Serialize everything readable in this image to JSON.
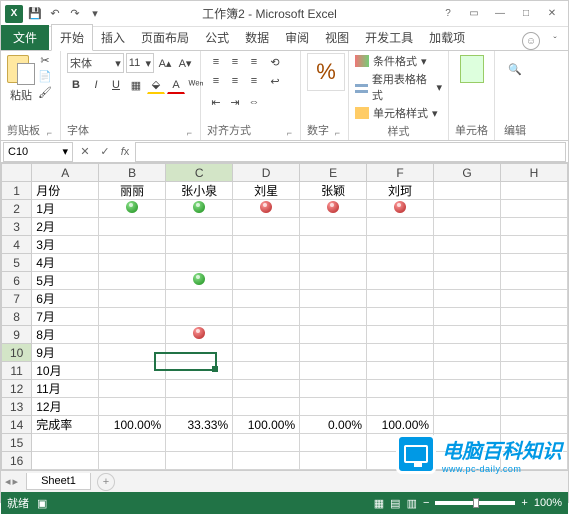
{
  "window": {
    "title": "工作簿2 - Microsoft Excel"
  },
  "qat": {
    "save": "💾",
    "undo": "↶",
    "redo": "↷",
    "customize": "▾"
  },
  "tabs": {
    "file": "文件",
    "home": "开始",
    "insert": "插入",
    "layout": "页面布局",
    "formulas": "公式",
    "data": "数据",
    "review": "审阅",
    "view": "视图",
    "developer": "开发工具",
    "addins": "加载项"
  },
  "ribbon": {
    "clipboard": {
      "paste": "粘贴",
      "label": "剪贴板"
    },
    "font": {
      "name": "宋体",
      "size": "11",
      "label": "字体"
    },
    "alignment": {
      "label": "对齐方式"
    },
    "number": {
      "label": "数字"
    },
    "styles": {
      "cond": "条件格式",
      "table": "套用表格格式",
      "cell": "单元格样式",
      "label": "样式"
    },
    "cells": {
      "label": "单元格"
    },
    "editing": {
      "label": "编辑"
    }
  },
  "namebox": {
    "value": "C10"
  },
  "columns": [
    "A",
    "B",
    "C",
    "D",
    "E",
    "F",
    "G",
    "H"
  ],
  "rows": [
    "1",
    "2",
    "3",
    "4",
    "5",
    "6",
    "7",
    "8",
    "9",
    "10",
    "11",
    "12",
    "13",
    "14",
    "15",
    "16"
  ],
  "active": {
    "col": "C",
    "row": "10"
  },
  "headers": {
    "month": "月份",
    "b": "丽丽",
    "c": "张小泉",
    "d": "刘星",
    "e": "张颖",
    "f": "刘珂"
  },
  "months": [
    "1月",
    "2月",
    "3月",
    "4月",
    "5月",
    "6月",
    "7月",
    "8月",
    "9月",
    "10月",
    "11月",
    "12月"
  ],
  "summary_label": "完成率",
  "summary": {
    "b": "100.00%",
    "c": "33.33%",
    "d": "100.00%",
    "e": "0.00%",
    "f": "100.00%"
  },
  "marks": {
    "r1": {
      "b": "green",
      "c": "green",
      "d": "red",
      "e": "red",
      "f": "red"
    },
    "r5": {
      "c": "green"
    },
    "r8": {
      "c": "red"
    }
  },
  "sheettab": {
    "name": "Sheet1"
  },
  "status": {
    "ready": "就绪",
    "zoom": "100%"
  },
  "watermark": {
    "cn": "电脑百科知识",
    "en": "www.pc-daily.com"
  },
  "chart_data": null
}
